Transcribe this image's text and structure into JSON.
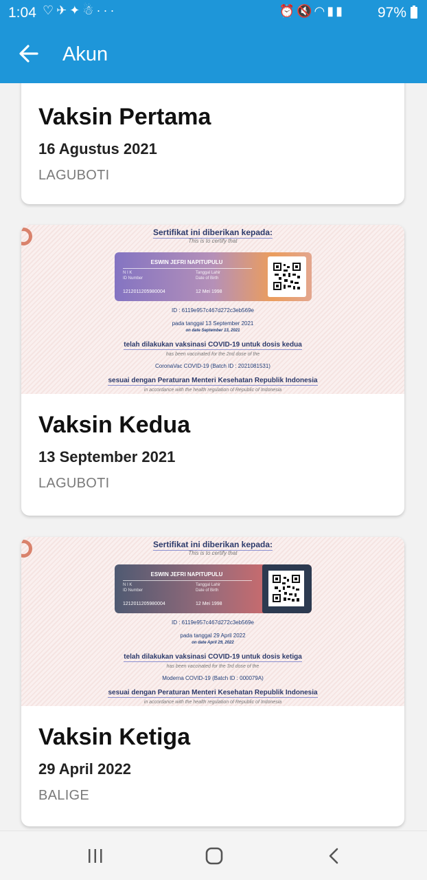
{
  "status_bar": {
    "time": "1:04",
    "left_icons": [
      "dating-app-icon",
      "bird-icon",
      "bird-alt-icon",
      "android-icon",
      "more-dots-icon"
    ],
    "right_icons": [
      "alarm-icon",
      "mute-icon",
      "wifi-icon",
      "signal-icon",
      "signal-icon"
    ],
    "battery": "97%"
  },
  "app_bar": {
    "title": "Akun",
    "background": "#1e96d9"
  },
  "vaccines": [
    {
      "name": "Vaksin Pertama",
      "date": "16 Agustus 2021",
      "location": "LAGUBOTI"
    },
    {
      "name": "Vaksin Kedua",
      "date": "13 September 2021",
      "location": "LAGUBOTI",
      "certificate": {
        "title": "Sertifikat ini diberikan kepada:",
        "subtitle": "This is to certify that",
        "holder_name": "ESWIN JEFRI NAPITUPULU",
        "nik_label": "N I K",
        "nik_sublabel": "ID Number",
        "nik": "1212011205980004",
        "dob_label": "Tanggal Lahir",
        "dob_sublabel": "Date of Birth",
        "dob": "12 Mei 1998",
        "id_line": "ID : 6119e957c467d272c3eb569e",
        "date_line": "pada tanggal 13 September 2021",
        "date_line_en": "on date September 13, 2021",
        "vaccinated_line": "telah dilakukan vaksinasi COVID-19 untuk dosis kedua",
        "vaccinated_line_en": "has been vaccinated for the 2nd dose of the",
        "batch": "CoronaVac COVID-19 (Batch ID : 2021081531)",
        "regulation": "sesuai dengan Peraturan Menteri Kesehatan Republik Indonesia",
        "regulation_en": "in accordance with the health regulation of Republic of Indonesia"
      }
    },
    {
      "name": "Vaksin Ketiga",
      "date": "29 April 2022",
      "location": "BALIGE",
      "certificate": {
        "title": "Sertifikat ini diberikan kepada:",
        "subtitle": "This is to certify that",
        "holder_name": "ESWIN JEFRI NAPITUPULU",
        "nik_label": "N I K",
        "nik_sublabel": "ID Number",
        "nik": "1212011205980004",
        "dob_label": "Tanggal Lahir",
        "dob_sublabel": "Date of Birth",
        "dob": "12 Mei 1998",
        "id_line": "ID : 6119e957c467d272c3eb569e",
        "date_line": "pada tanggal 29 April 2022",
        "date_line_en": "on date April 29, 2022",
        "vaccinated_line": "telah dilakukan vaksinasi COVID-19 untuk dosis ketiga",
        "vaccinated_line_en": "has been vaccinated for the 3rd dose of the",
        "batch": "Moderna COVID-19 (Batch ID : 000079A)",
        "regulation": "sesuai dengan Peraturan Menteri Kesehatan Republik Indonesia",
        "regulation_en": "in accordance with the health regulation of Republic of Indonesia"
      }
    }
  ],
  "nav_bar": {
    "buttons": [
      "recent-apps-icon",
      "home-icon",
      "back-icon"
    ]
  }
}
